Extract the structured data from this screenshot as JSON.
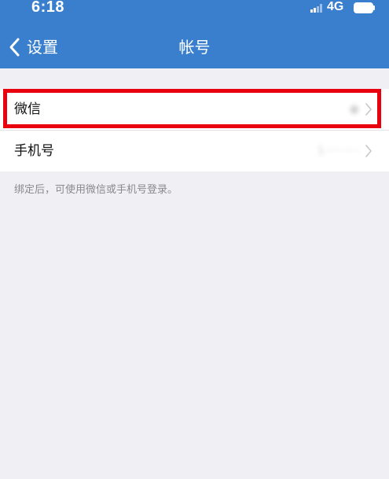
{
  "status_bar": {
    "time": "6:18",
    "network": "4G"
  },
  "nav": {
    "back_label": "设置",
    "title": "帐号"
  },
  "account_items": [
    {
      "label": "微信",
      "value": "●",
      "highlighted": true
    },
    {
      "label": "手机号",
      "value": "1··········",
      "highlighted": false
    }
  ],
  "footnote": "绑定后，可使用微信或手机号登录。",
  "colors": {
    "header_bg": "#3a7fcd",
    "page_bg": "#efeff4",
    "highlight": "#e8000f"
  }
}
